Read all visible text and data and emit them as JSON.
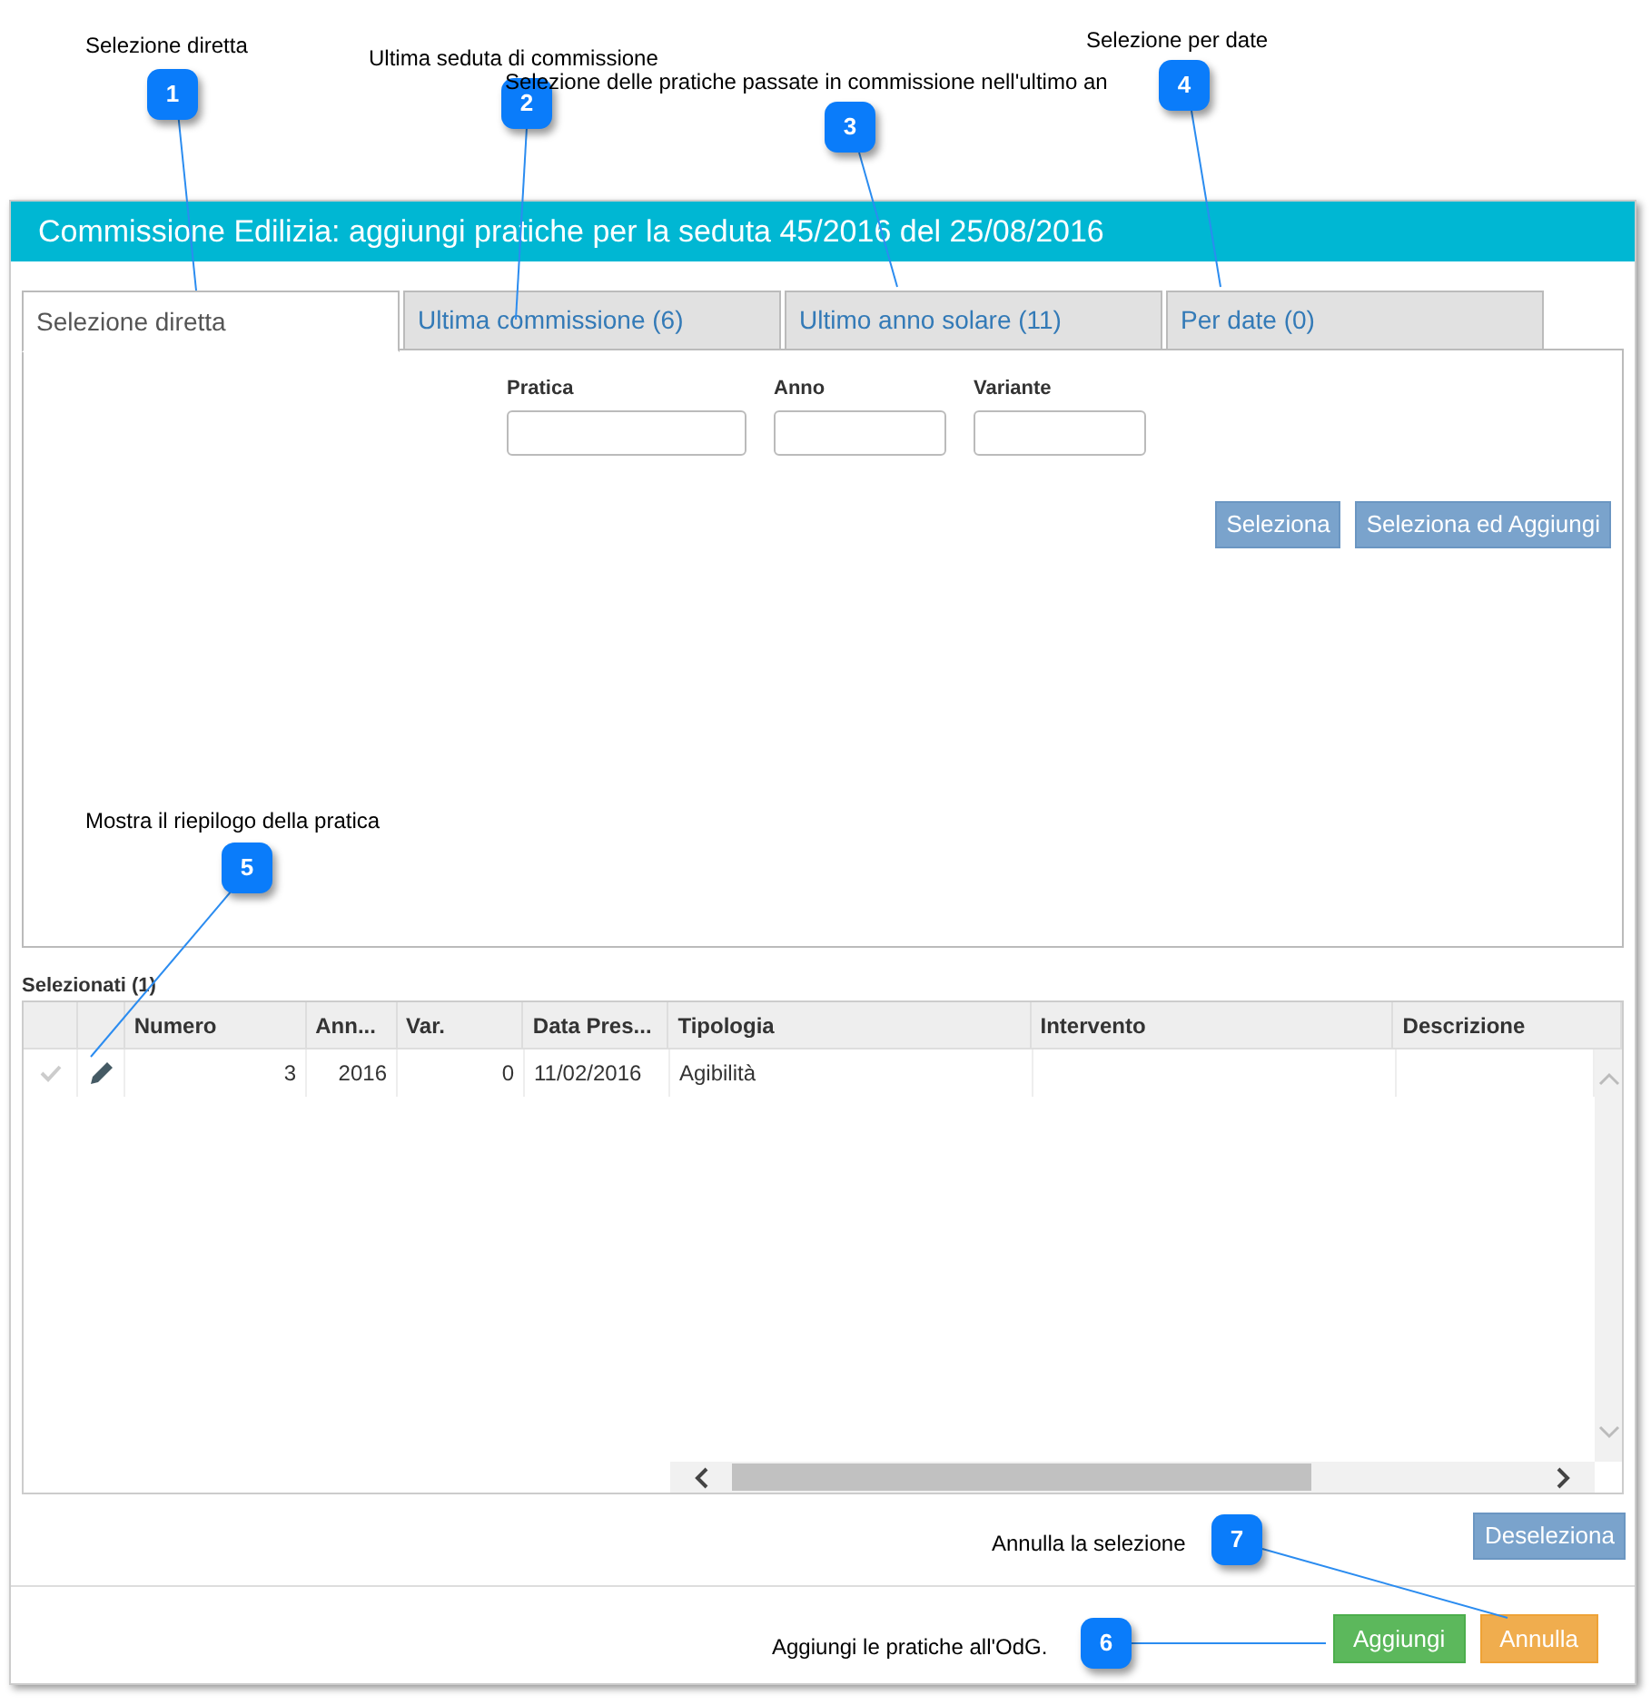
{
  "dialog": {
    "title": "Commissione Edilizia: aggiungi pratiche per la seduta 45/2016 del 25/08/2016",
    "tabs": [
      {
        "label": "Selezione diretta",
        "selected": true
      },
      {
        "label": "Ultima commissione (6)",
        "selected": false
      },
      {
        "label": "Ultimo anno solare (11)",
        "selected": false
      },
      {
        "label": "Per date (0)",
        "selected": false
      }
    ],
    "form": {
      "fields": [
        {
          "label": "Pratica"
        },
        {
          "label": "Anno"
        },
        {
          "label": "Variante"
        }
      ],
      "buttons": [
        "Seleziona",
        "Seleziona ed Aggiungi"
      ]
    },
    "selected_heading": "Selezionati (1)",
    "grid": {
      "columns": [
        "Numero",
        "Ann...",
        "Var.",
        "Data Pres...",
        "Tipologia",
        "Intervento",
        "Descrizione"
      ],
      "rows": [
        {
          "selected": false,
          "cells": [
            "3",
            "2016",
            "0",
            "11/02/2016",
            "Agibilità"
          ]
        }
      ]
    },
    "deselect_button": "Deseleziona",
    "footer_buttons": [
      {
        "label": "Aggiungi",
        "kind": "confirm"
      },
      {
        "label": "Annulla",
        "kind": "cancel"
      }
    ]
  },
  "callouts": [
    {
      "number": "1",
      "text": "Selezione diretta"
    },
    {
      "number": "2",
      "text": "Ultima seduta di commissione"
    },
    {
      "number": "3",
      "text": "Selezione delle pratiche passate in commissione nell'ultimo an"
    },
    {
      "number": "4",
      "text": "Selezione per date"
    },
    {
      "number": "5",
      "text": "Mostra il riepilogo della pratica"
    },
    {
      "number": "6",
      "text": "Aggiungi le pratiche all'OdG."
    },
    {
      "number": "7",
      "text": "Annulla la selezione"
    }
  ]
}
